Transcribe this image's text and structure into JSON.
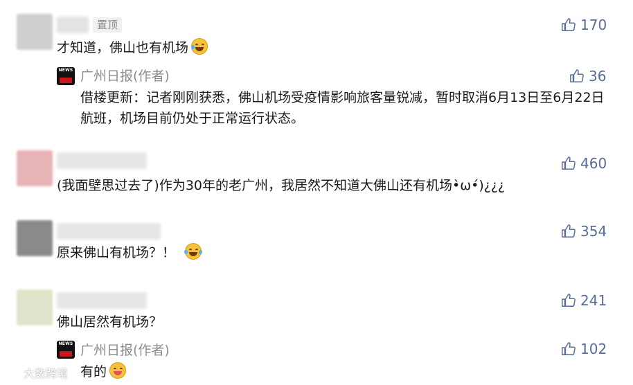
{
  "comments": [
    {
      "text": "才知道，佛山也有机场",
      "likes": "170",
      "pinned_label": "置顶",
      "emoji": "laughing-crying-emoji",
      "reply": {
        "author": "广州日报(作者)",
        "likes": "36",
        "text": "借楼更新：记者刚刚获悉，佛山机场受疫情影响旅客量锐减，暂时取消6月13日至6月22日航班，机场目前仍处于正常运行状态。"
      }
    },
    {
      "text": "(我面壁思过去了)作为30年的老广州，我居然不知道大佛山还有机场•̀ω•́)¿¿¿",
      "likes": "460"
    },
    {
      "text": "原来佛山有机场？！",
      "likes": "354",
      "emoji": "tears-of-joy-emoji"
    },
    {
      "text": "佛山居然有机场？",
      "likes": "241",
      "reply": {
        "author": "广州日报(作者)",
        "likes": "102",
        "text": "有的",
        "emoji": "winking-tongue-emoji"
      }
    }
  ],
  "watermark": "大数跨境",
  "colors": {
    "like_blue": "#576b95",
    "author_gray": "#8c8c8c",
    "text": "#1a1a1a",
    "pin_bg": "#f0f0f0"
  }
}
